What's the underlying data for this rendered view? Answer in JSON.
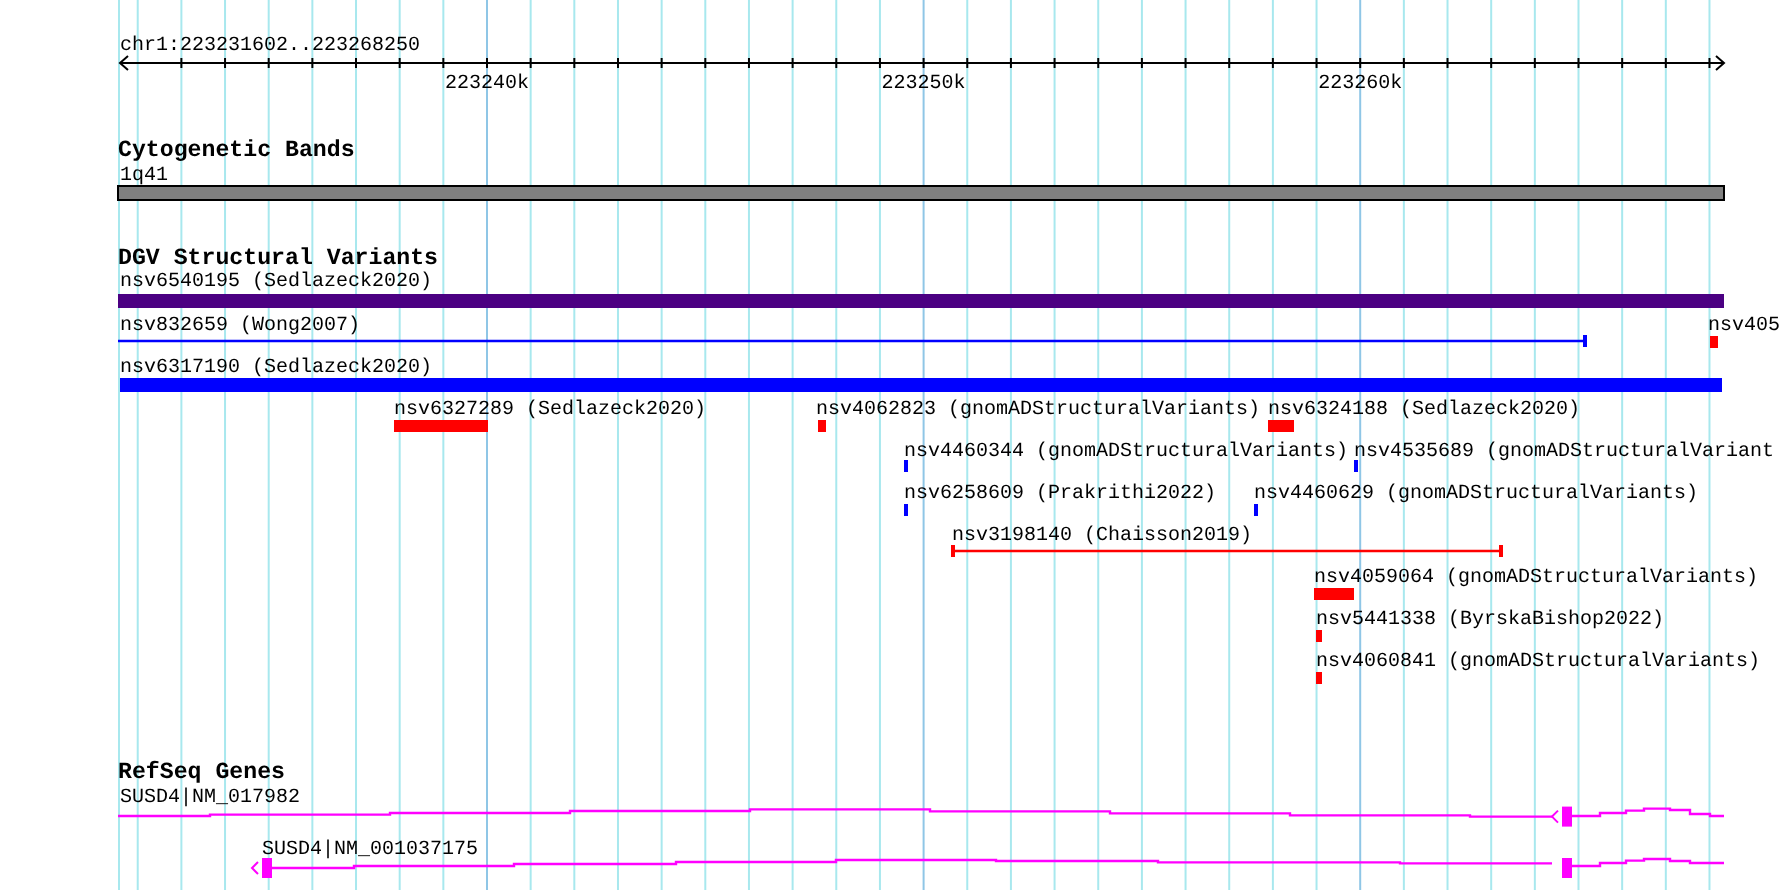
{
  "ruler": {
    "title": "chr1:223231602..223268250",
    "tick_labels": [
      "223240k",
      "223250k",
      "223260k"
    ]
  },
  "tracks": [
    {
      "title": "Cytogenetic Bands",
      "features": [
        {
          "label": "1q41",
          "kind": "band",
          "color": "#808080"
        }
      ]
    },
    {
      "title": "DGV Structural Variants",
      "features": [
        {
          "label": "nsv6540195 (Sedlazeck2020)",
          "kind": "bar",
          "color": "#4b0082"
        },
        {
          "label": "nsv832659 (Wong2007)",
          "kind": "span",
          "color": "#0000ff"
        },
        {
          "label": "nsv405",
          "kind": "bar",
          "color": "#ff0000"
        },
        {
          "label": "nsv6317190 (Sedlazeck2020)",
          "kind": "bar",
          "color": "#0000ff"
        },
        {
          "label": "nsv6327289 (Sedlazeck2020)",
          "kind": "bar",
          "color": "#ff0000"
        },
        {
          "label": "nsv4062823 (gnomADStructuralVariants)",
          "kind": "bar",
          "color": "#ff0000"
        },
        {
          "label": "nsv6324188 (Sedlazeck2020)",
          "kind": "bar",
          "color": "#ff0000"
        },
        {
          "label": "nsv4460344 (gnomADStructuralVariants)",
          "kind": "bar",
          "color": "#0000ff"
        },
        {
          "label": "nsv4535689 (gnomADStructuralVariant",
          "kind": "bar",
          "color": "#0000ff"
        },
        {
          "label": "nsv6258609 (Prakrithi2022)",
          "kind": "bar",
          "color": "#0000ff"
        },
        {
          "label": "nsv4460629 (gnomADStructuralVariants)",
          "kind": "bar",
          "color": "#0000ff"
        },
        {
          "label": "nsv3198140 (Chaisson2019)",
          "kind": "span",
          "color": "#ff0000"
        },
        {
          "label": "nsv4059064 (gnomADStructuralVariants)",
          "kind": "bar",
          "color": "#ff0000"
        },
        {
          "label": "nsv5441338 (ByrskaBishop2022)",
          "kind": "bar",
          "color": "#ff0000"
        },
        {
          "label": "nsv4060841 (gnomADStructuralVariants)",
          "kind": "bar",
          "color": "#ff0000"
        }
      ]
    },
    {
      "title": "RefSeq Genes",
      "features": [
        {
          "label": "SUSD4|NM_017982",
          "kind": "gene",
          "color": "#ff00ff"
        },
        {
          "label": "SUSD4|NM_001037175",
          "kind": "gene",
          "color": "#ff00ff"
        }
      ]
    }
  ]
}
